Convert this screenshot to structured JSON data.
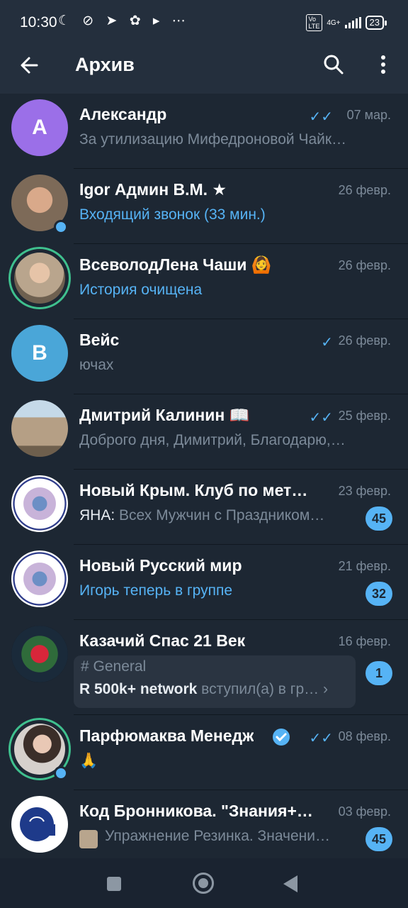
{
  "status": {
    "time": "10:30",
    "battery": "23",
    "net": "4G+"
  },
  "appbar": {
    "title": "Архив"
  },
  "chats": [
    {
      "name": "Александр",
      "date": "07 мар.",
      "message": "За утилизацию Мифедроновой Чайк…",
      "avatar_letter": "А",
      "avatar_color": "#9b6fe8",
      "read": "double"
    },
    {
      "name": "Igor Админ В.М. ★",
      "date": "26 февр.",
      "message": "Входящий звонок (33 мин.)",
      "avatar_color": "#a69077",
      "online": true
    },
    {
      "name": "ВсеволодЛена Чаши 🙆",
      "date": "26 февр.",
      "message": "История очищена",
      "avatar_color": "#8b7a66",
      "story_ring": true
    },
    {
      "name": "Вейс",
      "date": "26 февр.",
      "message": "ючах",
      "avatar_letter": "В",
      "avatar_color": "#4aa6d8",
      "read": "single"
    },
    {
      "name": "Дмитрий Калинин 📖",
      "date": "25 февр.",
      "message": "Доброго дня, Димитрий, Благодарю,…",
      "avatar_color": "#a89a86",
      "read": "double"
    },
    {
      "name": "Новый Крым. Клуб по мет…",
      "date": "23 февр.",
      "sender": "ЯНА:",
      "message": " Всех Мужчин с Праздником…",
      "badge": "45",
      "avatar_color": "#ffffff"
    },
    {
      "name": "Новый Русский мир",
      "date": "21 февр.",
      "message": "Игорь теперь в группе",
      "badge": "32",
      "avatar_color": "#ffffff"
    },
    {
      "name": "Казачий Спас 21 Век",
      "date": "16 февр.",
      "topic": "# General",
      "topic_sender": "R 500k+ network",
      "topic_message": " вступил(а) в гр…",
      "badge": "1",
      "avatar_color": "#10181f"
    },
    {
      "name": "Парфюмаква Менедж",
      "date": "08 февр.",
      "message": "🙏",
      "avatar_color": "#cfc6c1",
      "online": true,
      "story_ring": true,
      "read": "double"
    },
    {
      "name": "Код Бронникова. \"Знания+…",
      "date": "03 февр.",
      "message": "Упражнение Резинка. Значени…",
      "badge": "45",
      "avatar_color": "#ffffff"
    }
  ]
}
